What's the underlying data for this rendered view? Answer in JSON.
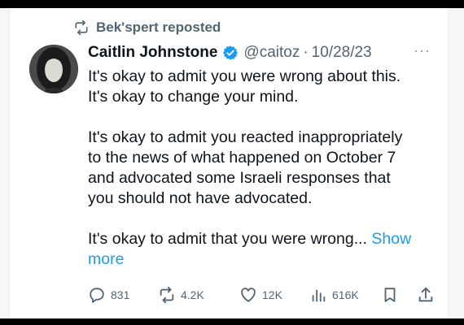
{
  "repost": {
    "label": "Bek'spert reposted"
  },
  "author": {
    "name": "Caitlin Johnstone",
    "handle": "@caitoz",
    "separator": "·",
    "date": "10/28/23"
  },
  "more_menu": "···",
  "tweet": {
    "paragraphs": [
      [
        "It's okay to admit you were wrong about this.",
        "It's okay to change your mind."
      ],
      [
        "It's okay to admit you reacted inappropriately",
        "to the news of what happened on October 7",
        "and advocated some Israeli responses that",
        "you should not have advocated."
      ]
    ],
    "last_line": "It's okay to admit that you were wrong...",
    "show_more": "Show more"
  },
  "actions": {
    "replies": "831",
    "reposts": "4.2K",
    "likes": "12K",
    "views": "616K"
  },
  "colors": {
    "accent": "#1d9bf0",
    "muted": "#536471",
    "text": "#0f1419"
  },
  "icons": [
    "repost-icon",
    "verified-badge-icon",
    "reply-icon",
    "repost-icon",
    "like-icon",
    "views-icon",
    "bookmark-icon",
    "share-icon"
  ]
}
